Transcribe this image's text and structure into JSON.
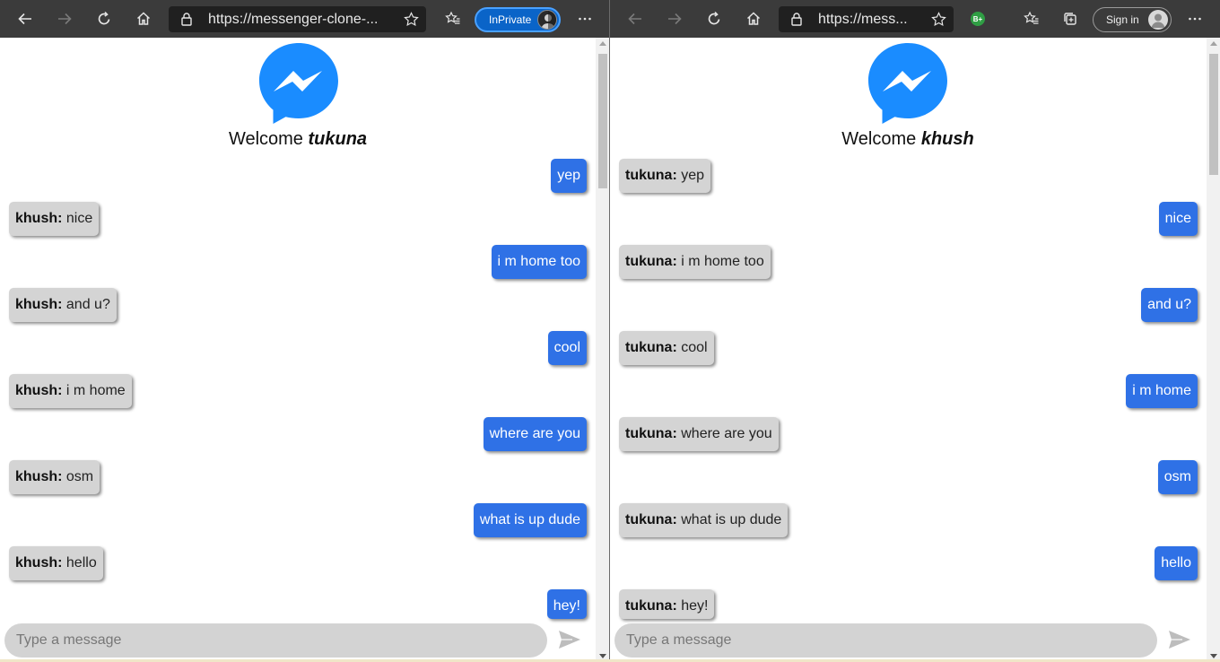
{
  "left_window": {
    "url": "https://messenger-clone-...",
    "inprivate_label": "InPrivate",
    "welcome_prefix": "Welcome",
    "username": "tukuna",
    "placeholder": "Type a message",
    "messages": [
      {
        "text": "yep"
      },
      {
        "sender": "khush:",
        "text": "nice"
      },
      {
        "text": "i m home too"
      },
      {
        "sender": "khush:",
        "text": "and u?"
      },
      {
        "text": "cool"
      },
      {
        "sender": "khush:",
        "text": "i m home"
      },
      {
        "text": "where are you"
      },
      {
        "sender": "khush:",
        "text": "osm"
      },
      {
        "text": "what is up dude"
      },
      {
        "sender": "khush:",
        "text": "hello"
      },
      {
        "text": "hey!"
      }
    ]
  },
  "right_window": {
    "url": "https://mess...",
    "extension_badge": "B+",
    "signin_label": "Sign in",
    "welcome_prefix": "Welcome",
    "username": "khush",
    "placeholder": "Type a message",
    "messages": [
      {
        "sender": "tukuna:",
        "text": "yep"
      },
      {
        "text": "nice"
      },
      {
        "sender": "tukuna:",
        "text": "i m home too"
      },
      {
        "text": "and u?"
      },
      {
        "sender": "tukuna:",
        "text": "cool"
      },
      {
        "text": "i m home"
      },
      {
        "sender": "tukuna:",
        "text": "where are you"
      },
      {
        "text": "osm"
      },
      {
        "sender": "tukuna:",
        "text": "what is up dude"
      },
      {
        "text": "hello"
      },
      {
        "sender": "tukuna:",
        "text": "hey!"
      }
    ]
  },
  "colors": {
    "outgoing_bubble": "#2f71e6",
    "incoming_bubble": "#d4d4d4",
    "toolbar": "#3b3b3b",
    "inprivate": "#0a64c8",
    "logo_blue": "#1a8cff"
  },
  "icons": [
    "back-icon",
    "forward-icon",
    "refresh-icon",
    "home-icon",
    "lock-icon",
    "favorite-star-icon",
    "favorites-icon",
    "collections-icon",
    "more-icon",
    "messenger-logo-icon",
    "send-icon"
  ]
}
